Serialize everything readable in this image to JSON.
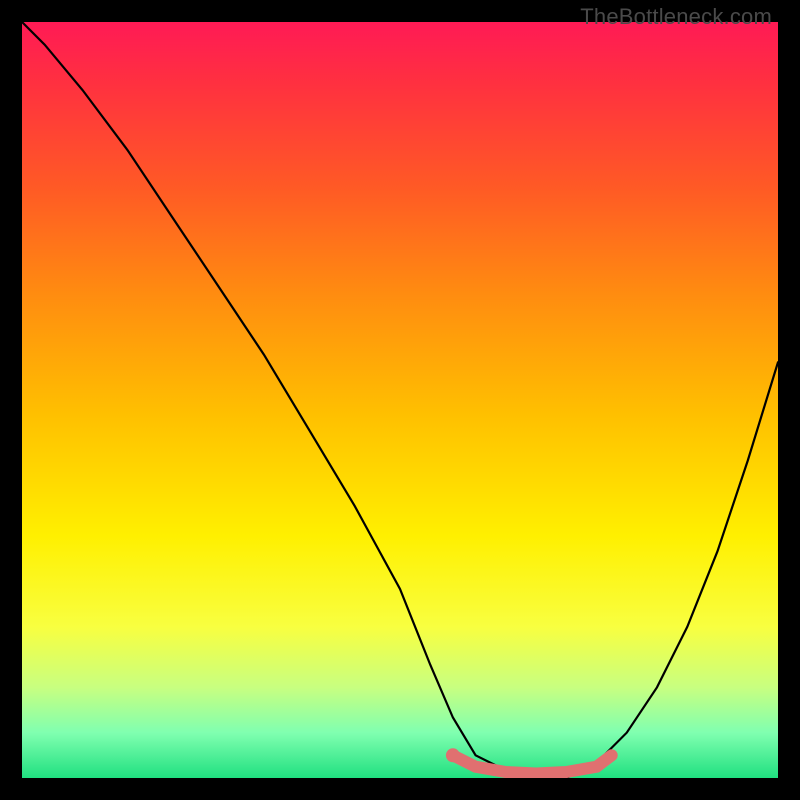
{
  "watermark": "TheBottleneck.com",
  "chart_data": {
    "type": "line",
    "title": "",
    "xlabel": "",
    "ylabel": "",
    "xlim": [
      0,
      100
    ],
    "ylim": [
      0,
      100
    ],
    "series": [
      {
        "name": "bottleneck-curve",
        "color": "#000000",
        "x": [
          0,
          3,
          8,
          14,
          20,
          26,
          32,
          38,
          44,
          50,
          54,
          57,
          60,
          64,
          68,
          72,
          76,
          80,
          84,
          88,
          92,
          96,
          100
        ],
        "values": [
          100,
          97,
          91,
          83,
          74,
          65,
          56,
          46,
          36,
          25,
          15,
          8,
          3,
          1,
          0,
          0,
          2,
          6,
          12,
          20,
          30,
          42,
          55
        ]
      },
      {
        "name": "sweet-spot-band",
        "color": "#e07070",
        "x": [
          57,
          60,
          64,
          68,
          72,
          76,
          78
        ],
        "values": [
          3,
          1.5,
          0.8,
          0.6,
          0.8,
          1.5,
          3
        ]
      }
    ],
    "markers": [
      {
        "name": "sweet-spot-start",
        "x": 57,
        "y": 3,
        "color": "#e07070"
      }
    ],
    "gradient_stops": [
      {
        "pos": 0,
        "color": "#ff1a55"
      },
      {
        "pos": 22,
        "color": "#ff5a25"
      },
      {
        "pos": 52,
        "color": "#ffc000"
      },
      {
        "pos": 80,
        "color": "#f8ff40"
      },
      {
        "pos": 100,
        "color": "#20e080"
      }
    ]
  }
}
